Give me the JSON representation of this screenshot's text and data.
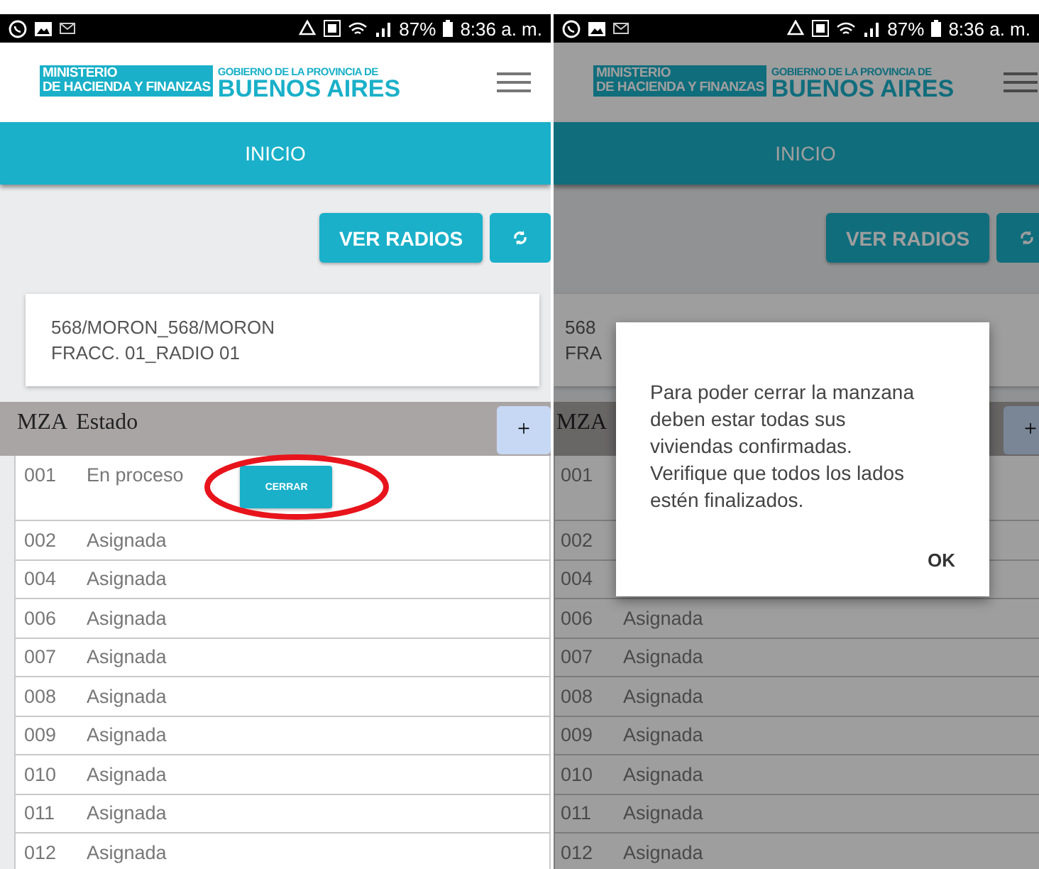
{
  "screens": [
    {
      "status_bar": {
        "battery": "87%",
        "time": "8:36 a. m."
      },
      "logo": {
        "ministry_line_1": "MINISTERIO",
        "ministry_line_2": "DE HACIENDA Y FINANZAS",
        "government": "GOBIERNO DE LA PROVINCIA DE",
        "province": "BUENOS AIRES"
      },
      "nav_title": "INICIO",
      "view_button": "VER RADIOS",
      "card_lines": [
        "568/MORON_568/MORON",
        "FRACC. 01_RADIO 01"
      ],
      "table": {
        "columns": [
          "MZA",
          "Estado"
        ],
        "add_label": "+",
        "rows": [
          {
            "mza": "001",
            "estado": "En proceso",
            "action": {
              "label": "CERRAR",
              "circled": true
            }
          },
          {
            "mza": "002",
            "estado": "Asignada"
          },
          {
            "mza": "004",
            "estado": "Asignada"
          },
          {
            "mza": "006",
            "estado": "Asignada"
          },
          {
            "mza": "007",
            "estado": "Asignada"
          },
          {
            "mza": "008",
            "estado": "Asignada"
          },
          {
            "mza": "009",
            "estado": "Asignada"
          },
          {
            "mza": "010",
            "estado": "Asignada"
          },
          {
            "mza": "011",
            "estado": "Asignada"
          },
          {
            "mza": "012",
            "estado": "Asignada"
          }
        ]
      }
    },
    {
      "status_bar": {
        "battery": "87%",
        "time": "8:36 a. m."
      },
      "logo": {
        "ministry_line_1": "MINISTERIO",
        "ministry_line_2": "DE HACIENDA Y FINANZAS",
        "government": "GOBIERNO DE LA PROVINCIA DE",
        "province": "BUENOS AIRES"
      },
      "nav_title": "INICIO",
      "view_button": "VER RADIOS",
      "card_lines": [
        "568",
        "FRA"
      ],
      "table": {
        "columns": [
          "MZA"
        ],
        "add_label": "+",
        "rows": [
          {
            "mza": "001"
          },
          {
            "mza": "002"
          },
          {
            "mza": "004"
          },
          {
            "mza": "006",
            "estado": "Asignada"
          },
          {
            "mza": "007",
            "estado": "Asignada"
          },
          {
            "mza": "008",
            "estado": "Asignada"
          },
          {
            "mza": "009",
            "estado": "Asignada"
          },
          {
            "mza": "010",
            "estado": "Asignada"
          },
          {
            "mza": "011",
            "estado": "Asignada"
          },
          {
            "mza": "012",
            "estado": "Asignada"
          }
        ]
      },
      "dialog": {
        "message": "Para poder cerrar la manzana deben estar todas sus viviendas confirmadas. Verifique que todos los lados estén finalizados.",
        "button": "OK"
      }
    }
  ]
}
